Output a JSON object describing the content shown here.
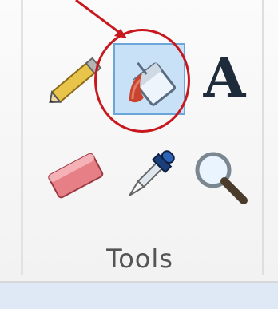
{
  "ribbon": {
    "group_label": "Tools",
    "tools": [
      {
        "name": "pencil",
        "icon": "pencil-icon"
      },
      {
        "name": "fill-with-color",
        "icon": "paint-bucket-icon",
        "selected": true
      },
      {
        "name": "text",
        "icon": "text-icon",
        "glyph": "A"
      },
      {
        "name": "eraser",
        "icon": "eraser-icon"
      },
      {
        "name": "color-picker",
        "icon": "eyedropper-icon"
      },
      {
        "name": "magnifier",
        "icon": "magnifier-icon"
      }
    ]
  },
  "annotation": {
    "color": "#c8171d"
  },
  "colors": {
    "selected_bg": "#c9e1f6",
    "selected_border": "#6aa6da"
  }
}
